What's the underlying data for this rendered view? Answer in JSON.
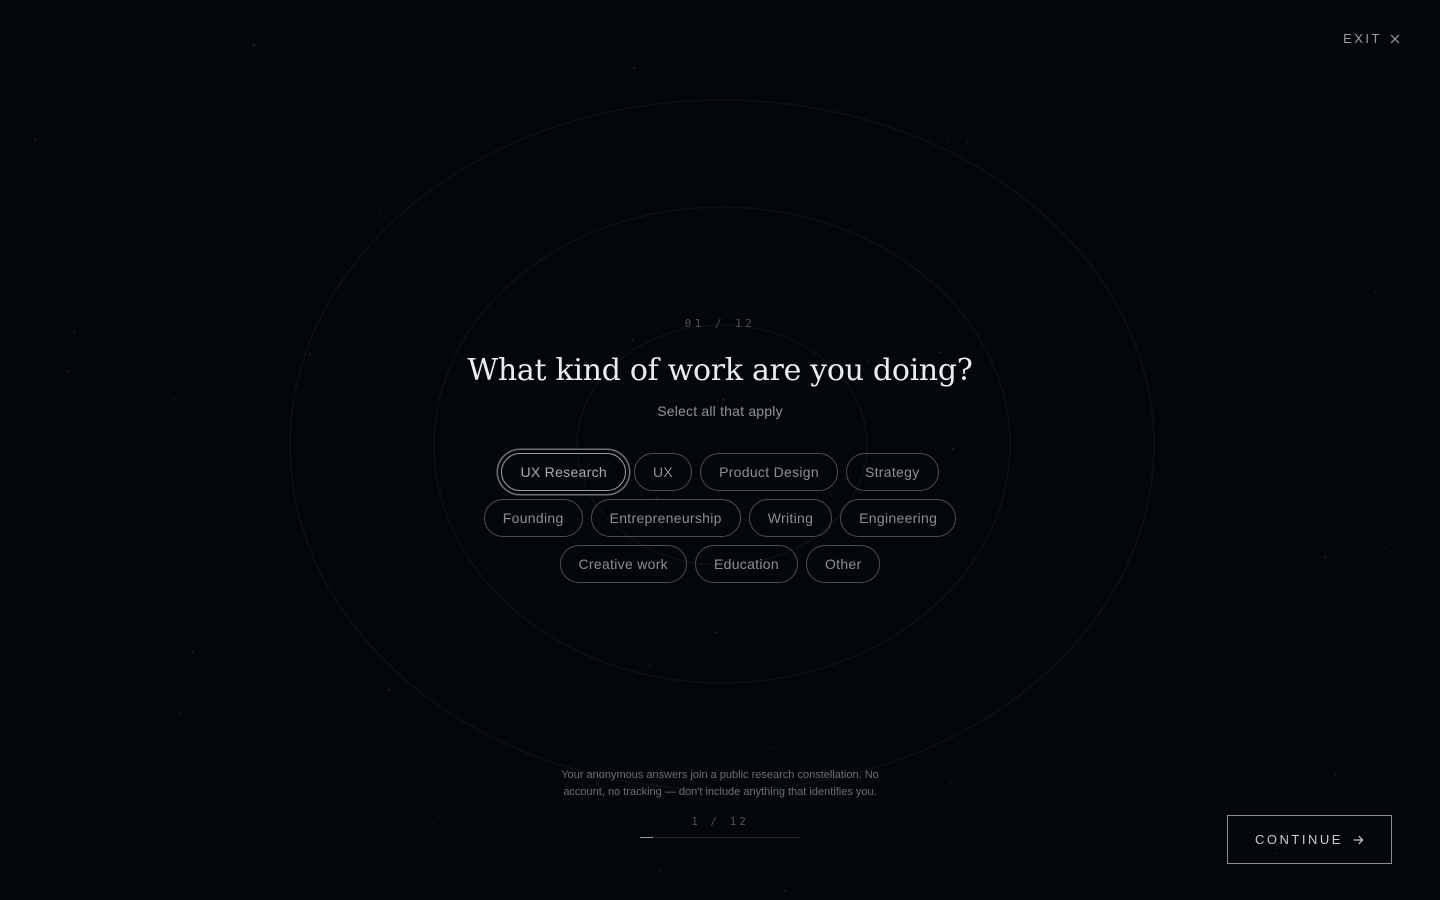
{
  "header": {
    "exit_label": "EXIT",
    "exit_icon": "close-icon"
  },
  "question": {
    "step_label": "01 / 12",
    "title": "What kind of work are you doing?",
    "subtitle": "Select all that apply",
    "options": [
      {
        "label": "UX Research",
        "selected": true
      },
      {
        "label": "UX",
        "selected": false
      },
      {
        "label": "Product Design",
        "selected": false
      },
      {
        "label": "Strategy",
        "selected": false
      },
      {
        "label": "Founding",
        "selected": false
      },
      {
        "label": "Entrepreneurship",
        "selected": false
      },
      {
        "label": "Writing",
        "selected": false
      },
      {
        "label": "Engineering",
        "selected": false
      },
      {
        "label": "Creative work",
        "selected": false
      },
      {
        "label": "Education",
        "selected": false
      },
      {
        "label": "Other",
        "selected": false
      }
    ]
  },
  "footer": {
    "notice_line1": "Your anonymous answers join a public research constellation. No",
    "notice_line2": "account, no tracking — don't include anything that identifies you.",
    "progress_label": "1 / 12",
    "progress_fraction": 0.083,
    "continue_label": "CONTINUE",
    "continue_icon": "arrow-right-icon"
  },
  "colors": {
    "background": "#03070b",
    "ring": "#0e1419",
    "chip_border": "#4a4d51",
    "selected_border": "#9a9da1"
  }
}
